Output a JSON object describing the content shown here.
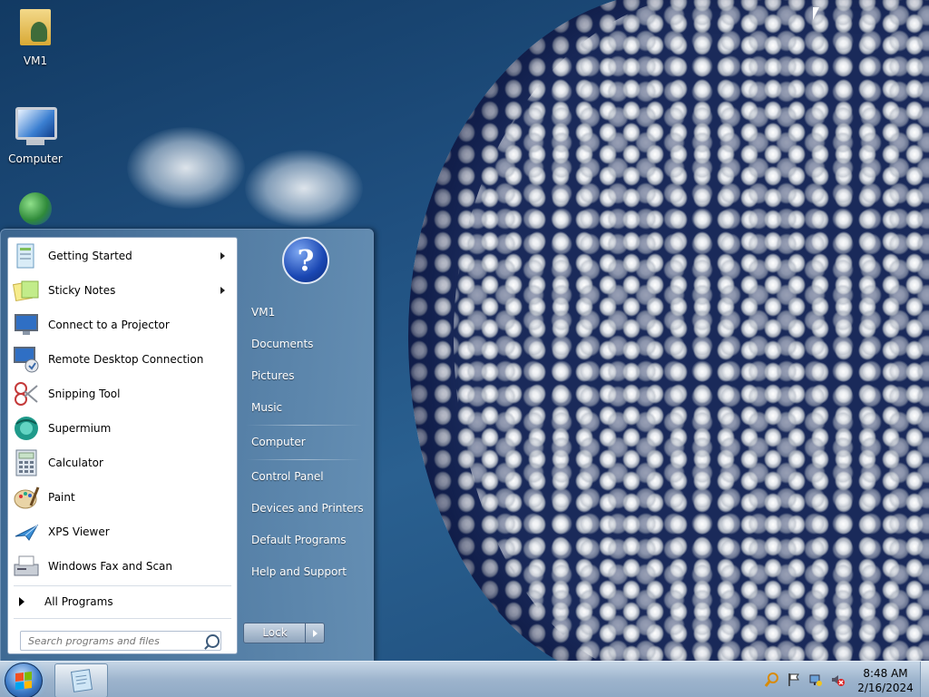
{
  "desktop": {
    "icons": [
      {
        "label": "VM1",
        "icon": "user-folder-icon"
      },
      {
        "label": "Computer",
        "icon": "computer-icon"
      },
      {
        "label": "",
        "icon": "network-globe-icon"
      }
    ]
  },
  "start_menu": {
    "programs": [
      {
        "label": "Getting Started",
        "icon": "getting-started-icon",
        "has_submenu": true
      },
      {
        "label": "Sticky Notes",
        "icon": "sticky-notes-icon",
        "has_submenu": true
      },
      {
        "label": "Connect to a Projector",
        "icon": "projector-icon",
        "has_submenu": false
      },
      {
        "label": "Remote Desktop Connection",
        "icon": "remote-desktop-icon",
        "has_submenu": false
      },
      {
        "label": "Snipping Tool",
        "icon": "scissors-icon",
        "has_submenu": false
      },
      {
        "label": "Supermium",
        "icon": "supermium-icon",
        "has_submenu": false
      },
      {
        "label": "Calculator",
        "icon": "calculator-icon",
        "has_submenu": false
      },
      {
        "label": "Paint",
        "icon": "paint-palette-icon",
        "has_submenu": false
      },
      {
        "label": "XPS Viewer",
        "icon": "xps-viewer-icon",
        "has_submenu": false
      },
      {
        "label": "Windows Fax and Scan",
        "icon": "fax-icon",
        "has_submenu": false
      }
    ],
    "all_programs_label": "All Programs",
    "search_placeholder": "Search programs and files",
    "right_items": [
      {
        "label": "VM1"
      },
      {
        "label": "Documents"
      },
      {
        "label": "Pictures"
      },
      {
        "label": "Music"
      },
      {
        "label": "Computer"
      },
      {
        "label": "Control Panel"
      },
      {
        "label": "Devices and Printers"
      },
      {
        "label": "Default Programs"
      },
      {
        "label": "Help and Support"
      }
    ],
    "help_glyph": "?",
    "lock_label": "Lock"
  },
  "taskbar": {
    "time": "8:48 AM",
    "date": "2/16/2024",
    "tray_icons": [
      "search-tray-icon",
      "action-center-flag-icon",
      "network-icon",
      "volume-muted-icon"
    ]
  },
  "colors": {
    "accent": "#3d7cc9",
    "taskbar": "#9db4cd"
  }
}
